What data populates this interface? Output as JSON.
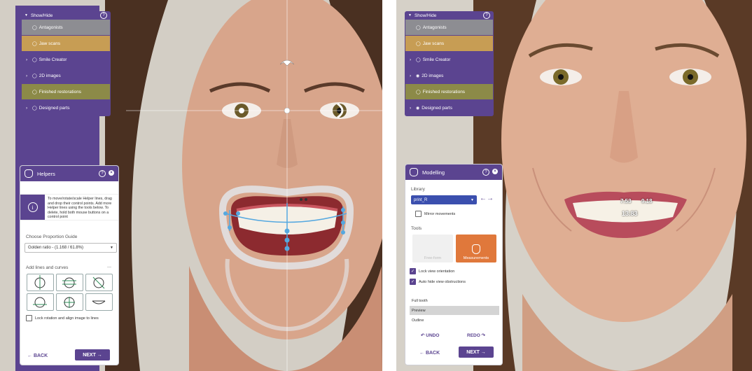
{
  "left": {
    "showhide": {
      "title": "Show/Hide",
      "help": "?",
      "items": [
        {
          "label": "Antagonists"
        },
        {
          "label": "Jaw scans"
        },
        {
          "label": "Smile Creator"
        },
        {
          "label": "2D images"
        },
        {
          "label": "Finished restorations"
        },
        {
          "label": "Designed parts"
        }
      ]
    },
    "helpers": {
      "title": "Helpers",
      "info_text": "To move/rotate/scale Helper lines, drag and drop their control points. Add more Helper lines using the tools below. To delete, hold both mouse buttons on a control point",
      "proportion_label": "Choose Proportion Guide",
      "proportion_value": "Golden ratio - (1.168 / 61.8%)",
      "lines_label": "Add lines and curves",
      "lock_label": "Lock rotation and align image to lines",
      "back": "← BACK",
      "next": "NEXT →"
    }
  },
  "right": {
    "showhide": {
      "title": "Show/Hide",
      "help": "?",
      "items": [
        {
          "label": "Antagonists"
        },
        {
          "label": "Jaw scans"
        },
        {
          "label": "Smile Creator"
        },
        {
          "label": "2D images"
        },
        {
          "label": "Finished restorations"
        },
        {
          "label": "Designed parts"
        }
      ]
    },
    "modelling": {
      "title": "Modelling",
      "library_label": "Library",
      "library_value": "print_R",
      "mirror_label": "Mirror movements",
      "tools_label": "Tools",
      "free_form": "Free-form",
      "measurements": "Measurements",
      "lock_view": "Lock view orientation",
      "auto_hide": "Auto hide view obstructions",
      "options": [
        "Full tooth",
        "Preview",
        "Outline"
      ],
      "undo": "↶ UNDO",
      "redo": "REDO ↷",
      "back": "← BACK",
      "next": "NEXT →"
    },
    "measurements": [
      "7.53",
      "9.18",
      "13.83"
    ]
  },
  "colors": {
    "purple": "#5b4490",
    "orange": "#e0783b",
    "blue_select": "#3b4fae",
    "helper_line": "#55a8e0"
  }
}
